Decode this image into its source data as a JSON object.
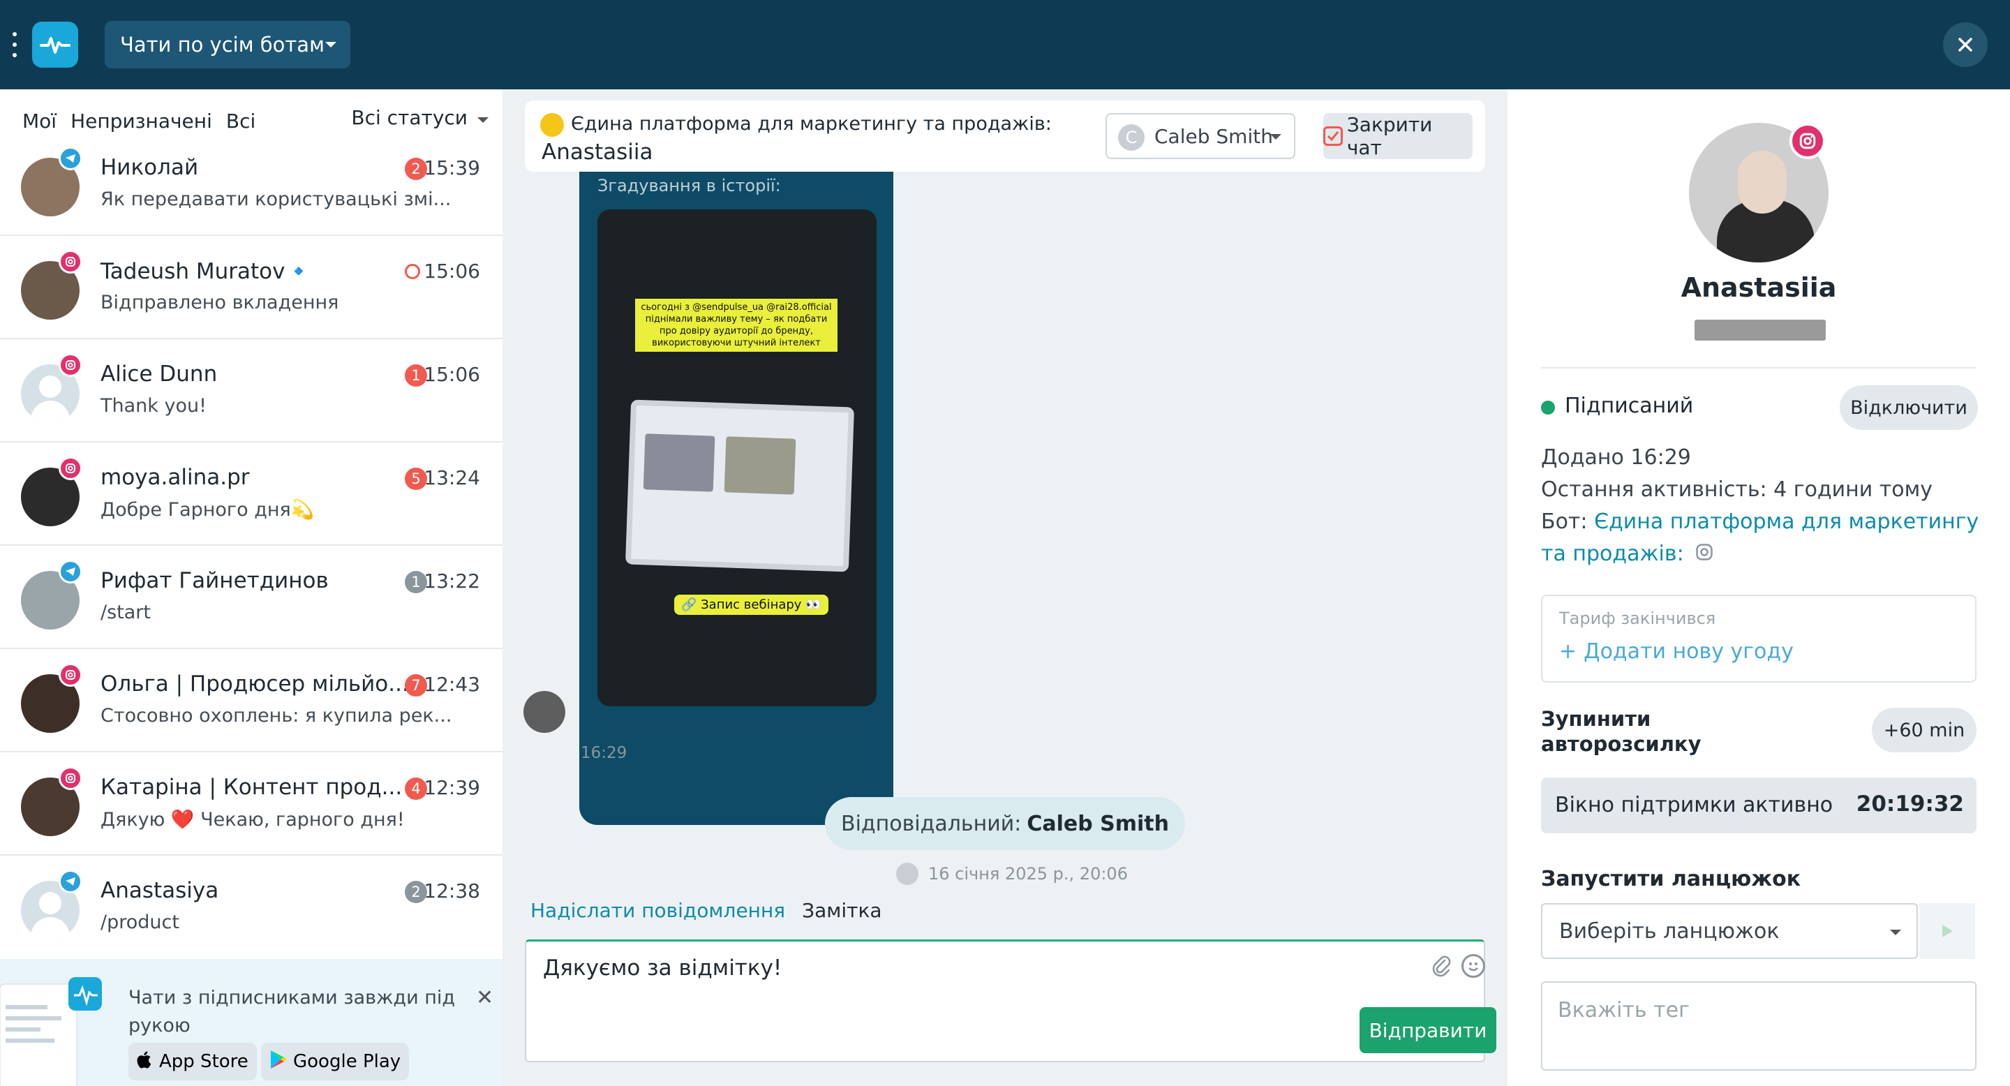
{
  "header": {
    "bot_selector_label": "Чати по усім ботам"
  },
  "filters": {
    "mine": "Мої",
    "unassigned": "Непризначені",
    "all": "Всі",
    "status": "Всі статуси"
  },
  "chats": [
    {
      "name": "Николай",
      "message": "Як передавати користувацькі змі...",
      "time": "15:39",
      "count": "2",
      "network": "telegram"
    },
    {
      "name": "Tadeush Muratov🔹",
      "message": "Відправлено вкладення",
      "time": "15:06",
      "count": "",
      "network": "instagram"
    },
    {
      "name": "Alice Dunn",
      "message": "Thank you!",
      "time": "15:06",
      "count": "1",
      "network": "instagram"
    },
    {
      "name": "moya.alina.pr",
      "message": "Добре Гарного дня💫",
      "time": "13:24",
      "count": "5",
      "network": "instagram"
    },
    {
      "name": "Рифат Гайнетдинов",
      "message": "/start",
      "time": "13:22",
      "count": "1",
      "network": "telegram"
    },
    {
      "name": "Ольга | Продюсер мільйо...",
      "message": "Стосовно охоплень: я купила рек...",
      "time": "12:43",
      "count": "7",
      "network": "instagram"
    },
    {
      "name": "Катаріна | Контент прод...",
      "message": "Дякую ❤️ Чекаю, гарного дня!",
      "time": "12:39",
      "count": "4",
      "network": "instagram"
    },
    {
      "name": "Anastasiya",
      "message": "/product",
      "time": "12:38",
      "count": "2",
      "network": "telegram"
    }
  ],
  "promo": {
    "text": "Чати з підписниками завжди під рукою",
    "app_store": "App Store",
    "google_play": "Google Play"
  },
  "conversation": {
    "bot_title": "Єдина платформа для маркетингу та продажів:",
    "contact_name": "Anastasiia",
    "assignee": "Caleb Smith",
    "assignee_initial": "C",
    "close_chat": "Закрити чат",
    "story_label": "Згадування в історії:",
    "story_caption": "сьогодні з @sendpulse_ua @rai28.official піднімали важливу тему – як подбати про довіру аудиторії до бренду, використовуючи штучний інтелект",
    "story_button": "🔗 Запис вебінару 👀",
    "message_time": "16:29",
    "responsible_label": "Відповідальний:",
    "responsible_name": "Caleb Smith",
    "date": "16 січня 2025 р., 20:06",
    "tab_send": "Надіслати повідомлення",
    "tab_note": "Замітка",
    "draft": "Дякуємо за відмітку!",
    "send": "Відправити"
  },
  "profile": {
    "name": "Anastasiia",
    "status": "Підписаний",
    "disconnect": "Відключити",
    "added": "Додано 16:29",
    "last_activity": "Остання активність: 4 години тому",
    "bot_prefix": "Бот:",
    "bot_link_line1": "Єдина платформа для маркетингу",
    "bot_link_line2": "та продажів:",
    "tariff_hint": "Тариф закінчився",
    "add_deal": "Додати нову угоду",
    "stop_autosend": "Зупинити авторозсилку",
    "plus_60": "+60 min",
    "support_window": "Вікно підтримки активно",
    "support_timer": "20:19:32",
    "chain_title": "Запустити ланцюжок",
    "chain_placeholder": "Виберіть ланцюжок",
    "tag_placeholder": "Вкажіть тег"
  },
  "colors": {
    "topbar": "#0e3b53",
    "accent": "#0d8ba8",
    "send": "#1aa36c",
    "badge_red": "#f05a4f",
    "instagram": "#e1306c",
    "telegram": "#2aa1da"
  }
}
